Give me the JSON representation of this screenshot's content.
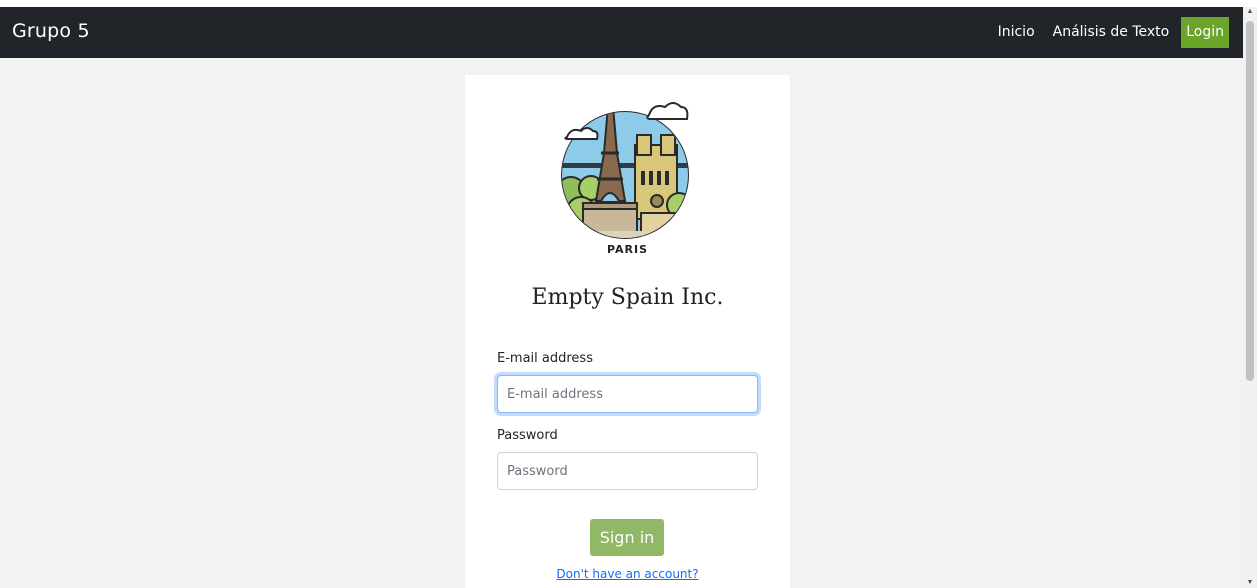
{
  "navbar": {
    "brand": "Grupo 5",
    "links": [
      {
        "label": "Inicio"
      },
      {
        "label": "Análisis de Texto"
      },
      {
        "label": "Login"
      }
    ]
  },
  "logo": {
    "caption": "PARIS",
    "icon": "paris-eiffel-tower-illustration"
  },
  "company": "Empty Spain Inc.",
  "form": {
    "email_label": "E-mail address",
    "email_placeholder": "E-mail address",
    "email_value": "",
    "password_label": "Password",
    "password_placeholder": "Password",
    "password_value": "",
    "submit_label": "Sign in",
    "register_link": "Don't have an account?"
  },
  "colors": {
    "navbar_bg": "#212529",
    "accent": "#6aa529",
    "button_bg": "#90b865",
    "link": "#0d6efd",
    "page_bg": "#f2f2f2"
  }
}
